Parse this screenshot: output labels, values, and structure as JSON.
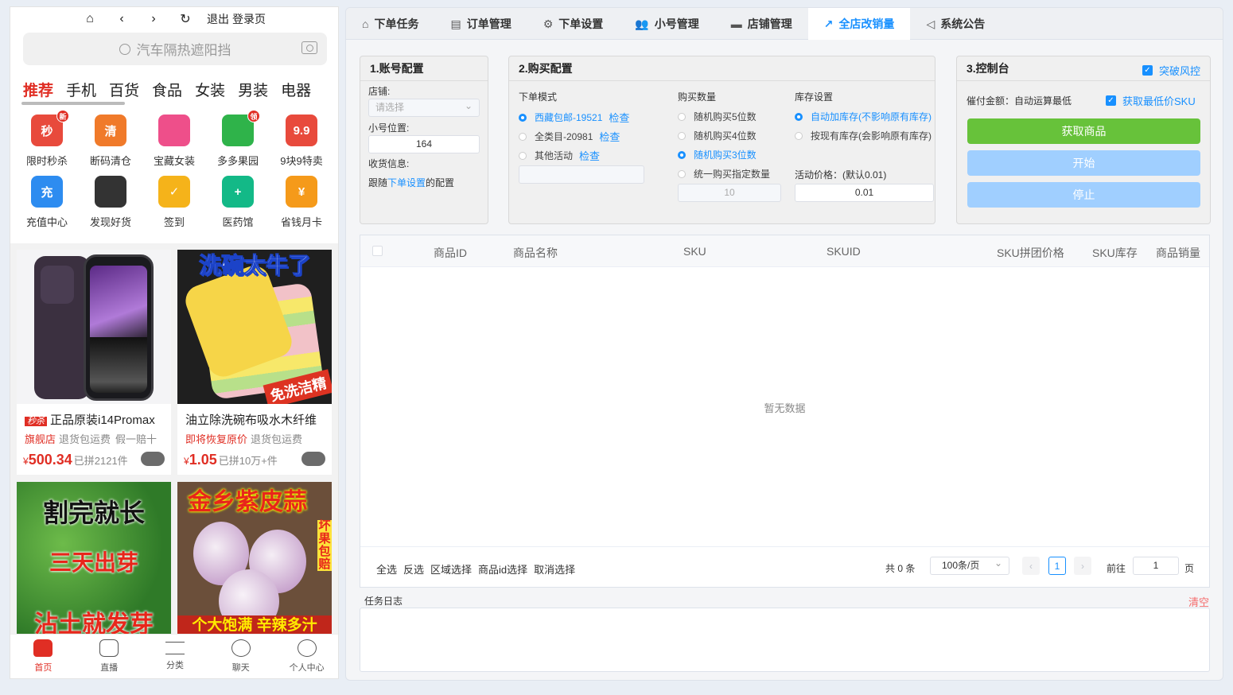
{
  "phone": {
    "nav": {
      "exit": "退出",
      "login": "登录页"
    },
    "search_placeholder": "汽车隔热遮阳挡",
    "categories": [
      "推荐",
      "手机",
      "百货",
      "食品",
      "女装",
      "男装",
      "电器"
    ],
    "shortcuts": [
      {
        "label": "限时秒杀",
        "glyph": "秒",
        "color": "#e84a3c",
        "badge": "新"
      },
      {
        "label": "断码清仓",
        "glyph": "清",
        "color": "#f07a2a",
        "badge": ""
      },
      {
        "label": "宝藏女装",
        "glyph": "",
        "color": "#ee4f8a",
        "badge": ""
      },
      {
        "label": "多多果园",
        "glyph": "",
        "color": "#2fb34a",
        "badge": "领"
      },
      {
        "label": "9块9特卖",
        "glyph": "9.9",
        "color": "#e84a3c",
        "badge": ""
      },
      {
        "label": "充值中心",
        "glyph": "充",
        "color": "#2d8cf0",
        "badge": ""
      },
      {
        "label": "发现好货",
        "glyph": "",
        "color": "#333333",
        "badge": ""
      },
      {
        "label": "签到",
        "glyph": "✓",
        "color": "#f5b31a",
        "badge": ""
      },
      {
        "label": "医药馆",
        "glyph": "+",
        "color": "#13b987",
        "badge": ""
      },
      {
        "label": "省钱月卡",
        "glyph": "¥",
        "color": "#f59a1a",
        "badge": ""
      }
    ],
    "products": [
      {
        "tag": "秒杀",
        "title": "正品原装i14Promax",
        "tag1": "旗舰店",
        "tag2": "退货包运费",
        "tag3": "假一赔十",
        "currency": "¥",
        "price": "500.34",
        "sold": "已拼2121件"
      },
      {
        "tag": "",
        "title": "油立除洗碗布吸水木纤维",
        "tag1": "即将恢复原价",
        "tag2": "退货包运费",
        "tag3": "",
        "currency": "¥",
        "price": "1.05",
        "sold": "已拼10万+件",
        "img_top": "洗碗太牛了",
        "img_bottom": "免洗洁精"
      },
      {
        "img_top": "割完就长",
        "img_mid": "三天出芽",
        "img_bottom": "沾土就发芽"
      },
      {
        "img_top": "金乡紫皮蒜",
        "img_side": "坏果包赔",
        "img_bottom": "个大饱满 辛辣多汁"
      }
    ],
    "tabbar": [
      "首页",
      "直播",
      "分类",
      "聊天",
      "个人中心"
    ]
  },
  "tabs": [
    "下单任务",
    "订单管理",
    "下单设置",
    "小号管理",
    "店铺管理",
    "全店改销量",
    "系统公告"
  ],
  "active_tab": 5,
  "account": {
    "title": "1.账号配置",
    "shop_label": "店铺:",
    "shop_placeholder": "请选择",
    "pos_label": "小号位置:",
    "pos_value": "164",
    "addr_label": "收货信息:",
    "addr_pre": "跟随",
    "addr_link": "下单设置",
    "addr_post": "的配置"
  },
  "purchase": {
    "title": "2.购买配置",
    "mode_label": "下单模式",
    "modes": [
      {
        "label": "西藏包邮-19521",
        "check": "检查",
        "selected": true
      },
      {
        "label": "全类目-20981",
        "check": "检查",
        "selected": false
      },
      {
        "label": "其他活动",
        "check": "检查",
        "selected": false
      }
    ],
    "qty_label": "购买数量",
    "qtys": [
      {
        "label": "随机购买5位数",
        "selected": false
      },
      {
        "label": "随机购买4位数",
        "selected": false
      },
      {
        "label": "随机购买3位数",
        "selected": true
      },
      {
        "label": "统一购买指定数量",
        "selected": false
      }
    ],
    "qty_value": "10",
    "stock_label": "库存设置",
    "stocks": [
      {
        "label": "自动加库存(不影响原有库存)",
        "selected": true
      },
      {
        "label": "按现有库存(会影响原有库存)",
        "selected": false
      }
    ],
    "price_label": "活动价格：(默认0.01)",
    "price_value": "0.01"
  },
  "console": {
    "title": "3.控制台",
    "breakout": "突破风控",
    "pay_label": "催付金额：自动运算最低",
    "lowest_sku": "获取最低价SKU",
    "btn_get": "获取商品",
    "btn_start": "开始",
    "btn_stop": "停止",
    "colors": {
      "get": "#67c23a",
      "start": "#a0cfff",
      "stop": "#a0cfff"
    }
  },
  "table": {
    "columns": [
      "商品ID",
      "商品名称",
      "SKU",
      "SKUID",
      "SKU拼团价格",
      "SKU库存",
      "商品销量"
    ],
    "empty": "暂无数据",
    "actions": [
      "全选",
      "反选",
      "区域选择",
      "商品id选择",
      "取消选择"
    ],
    "total": "共 0 条",
    "page_size": "100条/页",
    "page": "1",
    "goto": "前往",
    "goto_value": "1",
    "page_unit": "页"
  },
  "log": {
    "title": "任务日志",
    "clear": "清空"
  }
}
